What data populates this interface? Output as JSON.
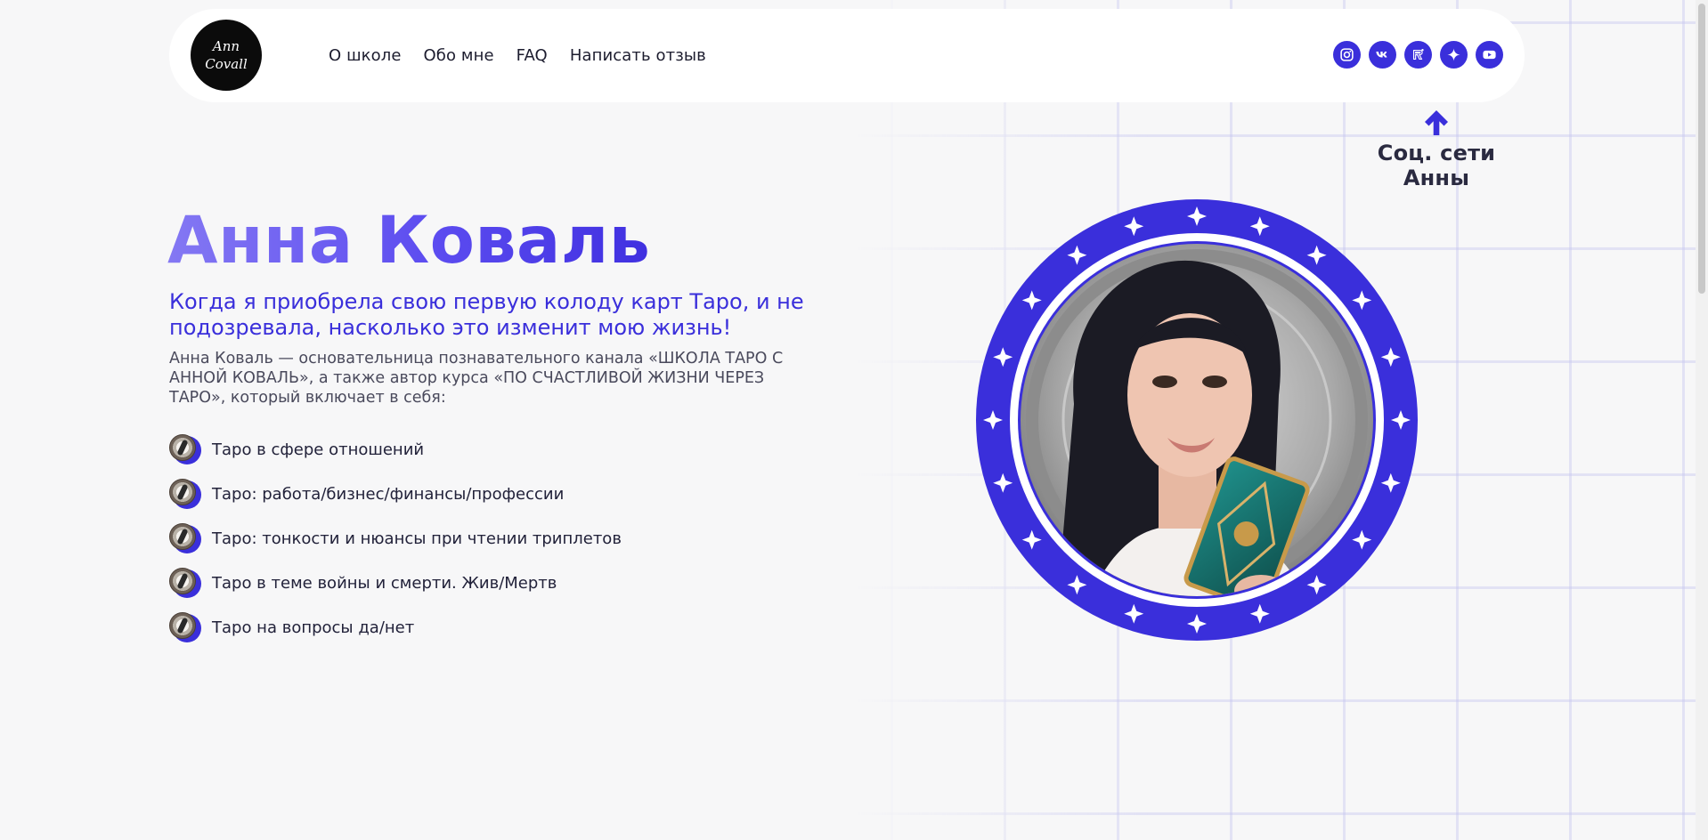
{
  "header": {
    "logo_line1": "Ann",
    "logo_line2": "Covall",
    "nav": [
      "О школе",
      "Обо мне",
      "FAQ",
      "Написать отзыв"
    ],
    "socials": [
      "instagram-icon",
      "vk-icon",
      "rutube-icon",
      "dzen-icon",
      "youtube-icon"
    ],
    "socials_hint": "Соц. сети Анны"
  },
  "hero": {
    "title": "Анна Коваль",
    "subtitle": "Когда я приобрела свою первую колоду карт Таро, и не подозревала, насколько это изменит мою жизнь!",
    "description": "Анна Коваль — основательница познавательного канала «ШКОЛА ТАРО С АННОЙ КОВАЛЬ», а также автор курса «ПО СЧАСТЛИВОЙ ЖИЗНИ ЧЕРЕЗ ТАРО», который включает в себя:",
    "topics": [
      "Таро в сфере отношений",
      "Таро: работа/бизнес/финансы/профессии",
      "Таро: тонкости и нюансы при чтении триплетов",
      "Таро в теме войны и смерти. Жив/Мертв",
      "Таро на вопросы да/нет"
    ]
  },
  "colors": {
    "accent": "#3a2fdb",
    "title_gradient_start": "#8478f3",
    "background": "#f7f7f8"
  }
}
